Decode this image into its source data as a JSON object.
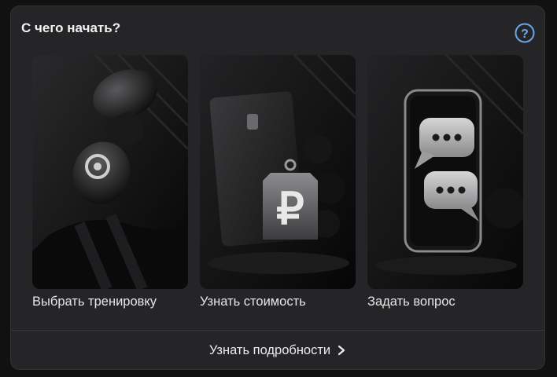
{
  "header": {
    "title": "С чего начать?",
    "help_icon": "question-circle-icon",
    "help_glyph": "?",
    "accent_color": "#6aa7e6"
  },
  "tiles": [
    {
      "label": "Выбрать тренировку",
      "image": "boxing-gloves-and-black-belt"
    },
    {
      "label": "Узнать стоимость",
      "image": "card-with-ruble-price-tag",
      "glyph": "₽"
    },
    {
      "label": "Задать вопрос",
      "image": "phone-with-chat-bubbles"
    }
  ],
  "footer": {
    "more_label": "Узнать подробности",
    "more_icon": "chevron-right-icon"
  }
}
